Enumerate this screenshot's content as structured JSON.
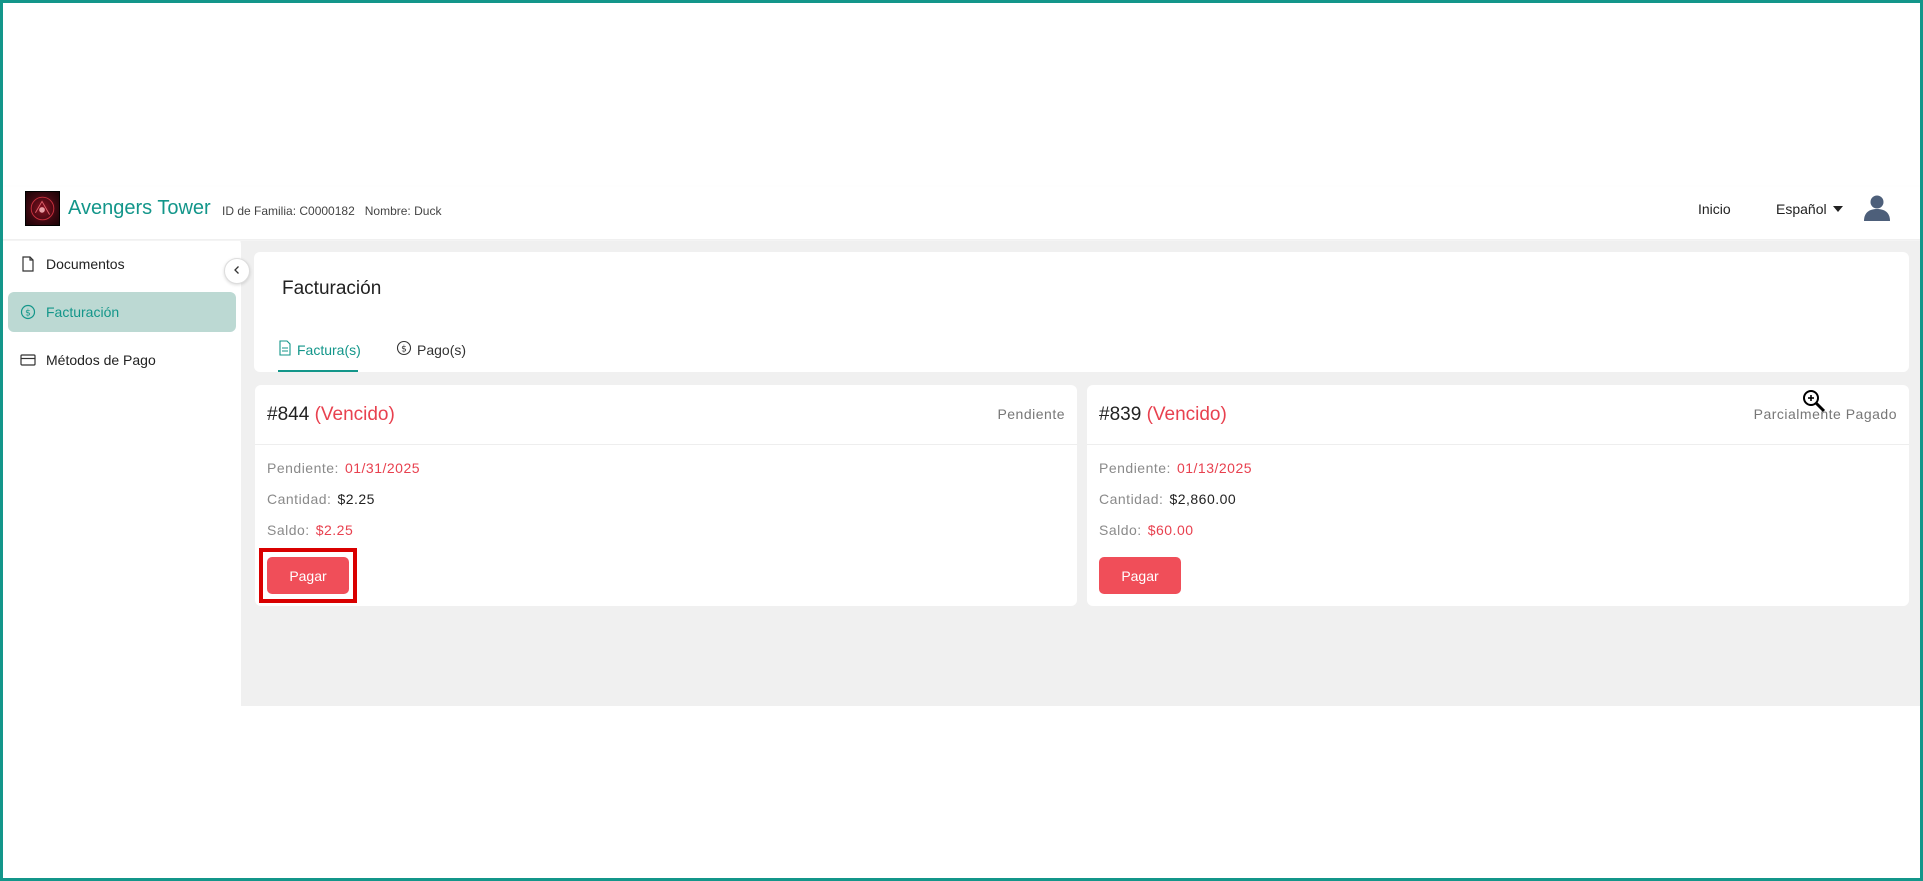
{
  "header": {
    "brand": "Avengers Tower",
    "family_id": "ID de Familia: C0000182",
    "name": "Nombre: Duck",
    "nav_home": "Inicio",
    "language": "Español"
  },
  "sidebar": {
    "items": [
      {
        "label": "Documentos",
        "icon": "document-icon"
      },
      {
        "label": "Facturación",
        "icon": "dollar-circle-icon",
        "active": true
      },
      {
        "label": "Métodos de Pago",
        "icon": "credit-card-icon"
      }
    ]
  },
  "main": {
    "title": "Facturación",
    "tabs": [
      {
        "label": "Factura(s)",
        "icon": "invoice-icon",
        "active": true
      },
      {
        "label": "Pago(s)",
        "icon": "dollar-circle-icon"
      }
    ]
  },
  "invoices": [
    {
      "number": "#844",
      "overdue": "(Vencido)",
      "status": "Pendiente",
      "due_label": "Pendiente:",
      "due_date": "01/31/2025",
      "amount_label": "Cantidad:",
      "amount": "$2.25",
      "balance_label": "Saldo:",
      "balance": "$2.25",
      "pay_label": "Pagar"
    },
    {
      "number": "#839",
      "overdue": "(Vencido)",
      "status": "Parcialmente Pagado",
      "due_label": "Pendiente:",
      "due_date": "01/13/2025",
      "amount_label": "Cantidad:",
      "amount": "$2,860.00",
      "balance_label": "Saldo:",
      "balance": "$60.00",
      "pay_label": "Pagar"
    }
  ],
  "colors": {
    "accent": "#13968a",
    "active_bg": "#bcd9d3",
    "danger": "#e8414f",
    "button": "#f04e59",
    "highlight": "#d90000"
  }
}
